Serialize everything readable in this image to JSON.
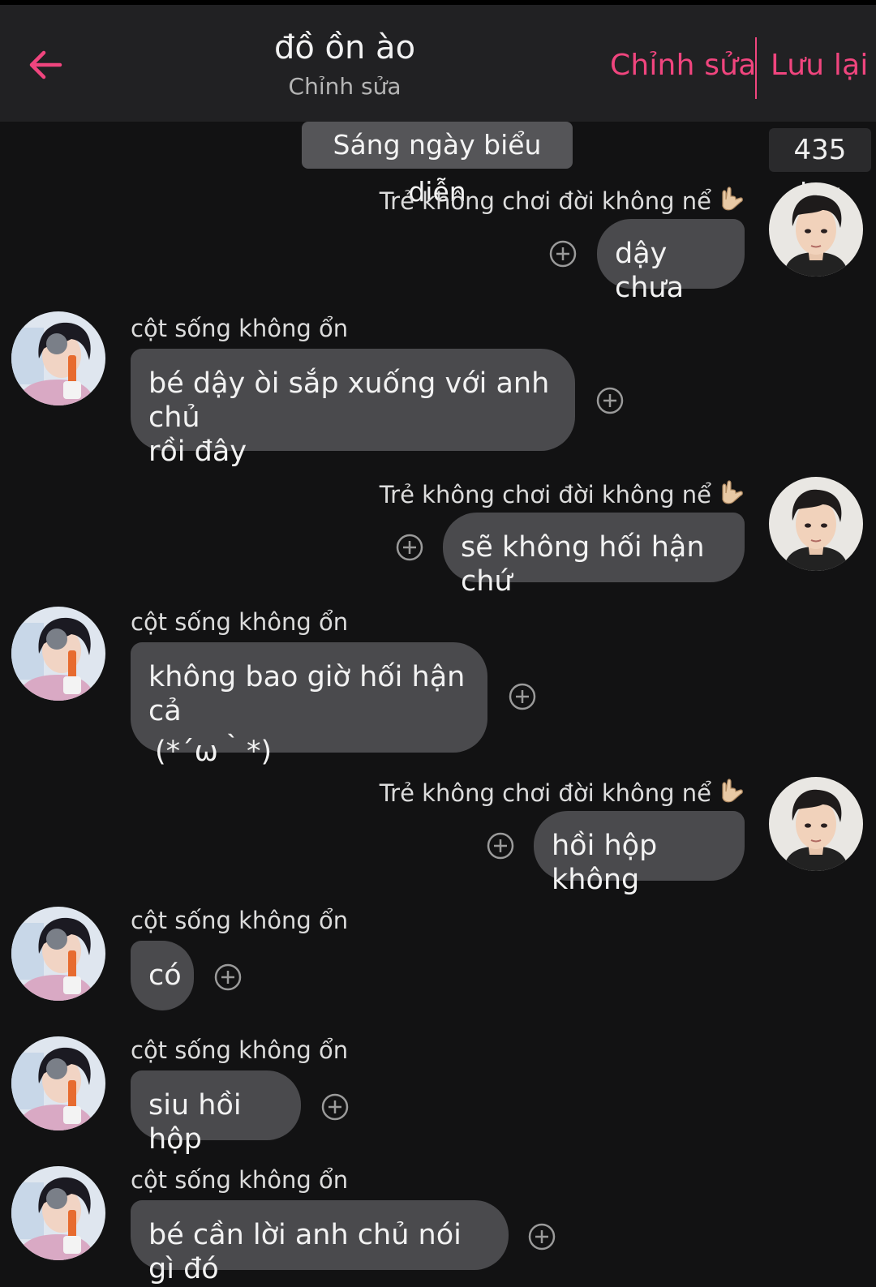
{
  "header": {
    "title": "đồ ồn ào",
    "subtitle": "Chỉnh sửa",
    "edit_label": "Chỉnh sửa",
    "save_label": "Lưu lại"
  },
  "scene_label": "Sáng ngày biểu diễn",
  "joy": "435 joy",
  "colors": {
    "accent": "#f0457e",
    "background": "#121213",
    "header_bg": "#212123",
    "bubble": "#4a4a4d"
  },
  "messages": [
    {
      "side": "right",
      "name": "Trẻ không chơi đời không nể",
      "text": "dậy chưa"
    },
    {
      "side": "left",
      "name": "cột sống không ổn",
      "text_lines": [
        "bé dậy òi sắp xuống với anh chủ",
        "rồi đây"
      ]
    },
    {
      "side": "right",
      "name": "Trẻ không chơi đời không nể",
      "text": "sẽ không hối hận chứ"
    },
    {
      "side": "left",
      "name": "cột sống không ổn",
      "text_lines": [
        "không bao giờ hối hận cả",
        "(*´ω｀*)"
      ]
    },
    {
      "side": "right",
      "name": "Trẻ không chơi đời không nể",
      "text": "hồi hộp không"
    },
    {
      "side": "left",
      "name": "cột sống không ổn",
      "text": "có"
    },
    {
      "side": "left",
      "name": "cột sống không ổn",
      "text": "siu hồi hộp"
    },
    {
      "side": "left",
      "name": "cột sống không ổn",
      "text": "bé cần lời anh chủ nói gì đó"
    }
  ]
}
